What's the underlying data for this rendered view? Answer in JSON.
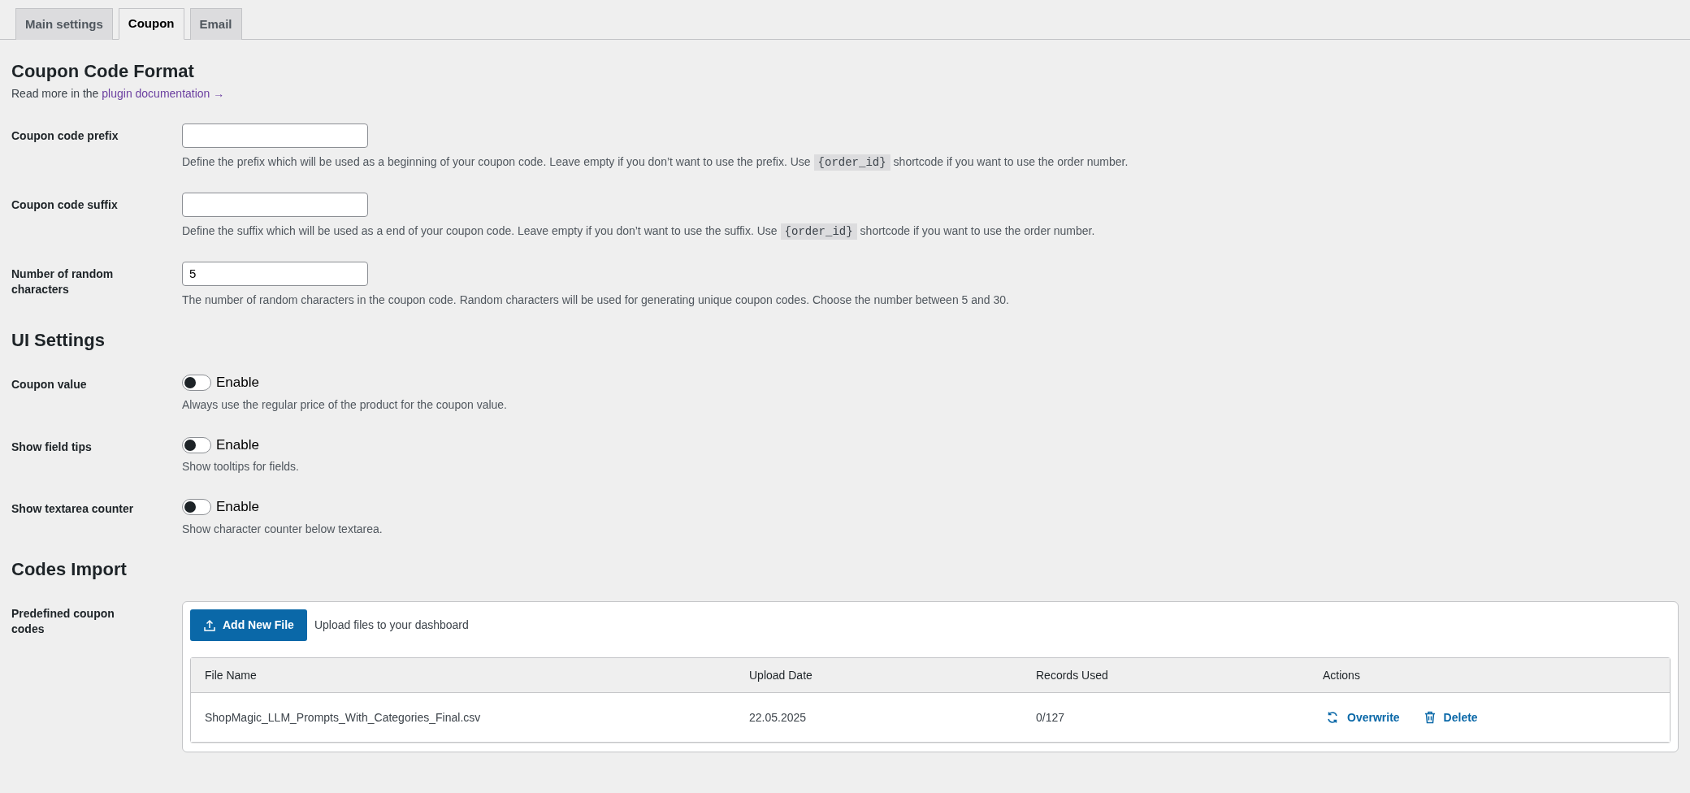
{
  "tabs": [
    {
      "label": "Main settings",
      "selected": false
    },
    {
      "label": "Coupon",
      "selected": true
    },
    {
      "label": "Email",
      "selected": false
    }
  ],
  "sections": [
    {
      "title": "Coupon Code Format",
      "intro": {
        "text": "Read more in the",
        "link": "plugin documentation →"
      },
      "fields": [
        {
          "kind": "text",
          "label": "Coupon code prefix",
          "description": [
            {
              "kind": "text",
              "text": "Define the prefix which will be used as a beginning of your coupon code. Leave empty if you don’t want to use the prefix. Use"
            },
            {
              "kind": "code",
              "text": "{order_id}"
            },
            {
              "kind": "text",
              "text": "shortcode if you want to use the order number."
            }
          ]
        },
        {
          "kind": "text",
          "label": "Coupon code suffix",
          "description": [
            {
              "kind": "text",
              "text": "Define the suffix which will be used as a end of your coupon code. Leave empty if you don’t want to use the suffix. Use"
            },
            {
              "kind": "code",
              "text": "{order_id}"
            },
            {
              "kind": "text",
              "text": "shortcode if you want to use the order number."
            }
          ]
        },
        {
          "kind": "text",
          "label": "Number of random characters",
          "value": "5",
          "description": [
            {
              "kind": "text",
              "text": "The number of random characters in the coupon code. Random characters will be used for generating unique coupon codes. Choose the number between 5 and 30."
            }
          ]
        }
      ]
    },
    {
      "title": "UI Settings",
      "fields": [
        {
          "kind": "toggle",
          "label": "Coupon value",
          "toggle_label": "Enable",
          "on": false,
          "description": [
            {
              "kind": "text",
              "text": "Always use the regular price of the product for the coupon value."
            }
          ]
        },
        {
          "kind": "toggle",
          "label": "Show field tips",
          "toggle_label": "Enable",
          "on": false,
          "description": [
            {
              "kind": "text",
              "text": "Show tooltips for fields."
            }
          ]
        },
        {
          "kind": "toggle",
          "label": "Show textarea counter",
          "toggle_label": "Enable",
          "on": false,
          "description": [
            {
              "kind": "text",
              "text": "Show character counter below textarea."
            }
          ]
        }
      ]
    },
    {
      "title": "Codes Import",
      "fields": [
        {
          "kind": "upload",
          "label": "Predefined coupon codes",
          "button": "Add New File",
          "hint": "Upload files to your dashboard",
          "table": {
            "columns": [
              "File Name",
              "Upload Date",
              "Records Used",
              "Actions"
            ],
            "rows": [
              {
                "file_name": "ShopMagic_LLM_Prompts_With_Categories_Final.csv",
                "upload_date": "22.05.2025",
                "records_used": "0/127",
                "actions": [
                  "Overwrite",
                  "Delete"
                ]
              }
            ]
          }
        }
      ]
    }
  ]
}
